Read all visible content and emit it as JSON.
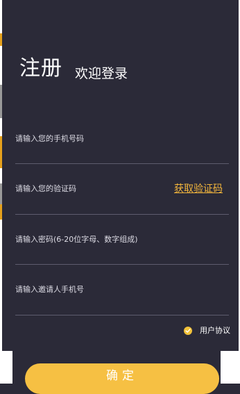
{
  "header": {
    "title": "注册",
    "subtitle": "欢迎登录"
  },
  "form": {
    "phone_placeholder": "请输入您的手机号码",
    "code_placeholder": "请输入您的验证码",
    "get_code_label": "获取验证码",
    "password_placeholder": "请输入密码(6-20位字母、数字组成)",
    "inviter_placeholder": "请输入邀请人手机号",
    "agreement_label": "用户协议",
    "agreement_checked": true,
    "confirm_label": "确定"
  },
  "colors": {
    "background": "#2b2a38",
    "accent": "#f6c043",
    "link": "#f2b53c"
  }
}
